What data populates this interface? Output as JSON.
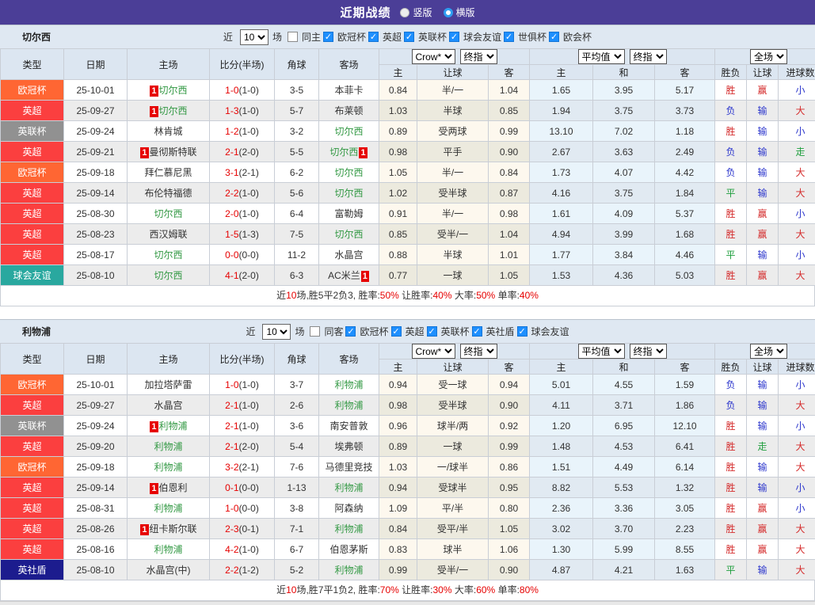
{
  "topbar": {
    "title": "近期战绩",
    "options": [
      {
        "label": "竖版",
        "selected": true
      },
      {
        "label": "横版",
        "selected": false
      }
    ]
  },
  "colors": {
    "topbar_bg": "#4b3e97",
    "section_band_bg": "#dfe8f2",
    "header_bg": "#dce6f1",
    "score_red": "#e60000",
    "team_green": "#339944"
  },
  "type_colors": {
    "欧冠杯": "#ff6633",
    "英超": "#fb3f3f",
    "英联杯": "#919191",
    "球会友谊": "#29a89f",
    "英社盾": "#1c1c8e"
  },
  "result_colors": {
    "胜": "red",
    "负": "blue",
    "平": "green",
    "赢": "red",
    "输": "blue",
    "走": "green",
    "大": "red",
    "小": "blue"
  },
  "table_header": {
    "cols": [
      "类型",
      "日期",
      "主场",
      "比分(半场)",
      "角球",
      "客场"
    ],
    "odds_group": {
      "selects": [
        "Crow*",
        "终指"
      ],
      "cols": [
        "主",
        "让球",
        "客"
      ]
    },
    "avg_group": {
      "selects": [
        "平均值",
        "终指"
      ],
      "cols": [
        "主",
        "和",
        "客"
      ]
    },
    "result_group": {
      "selects": [
        "全场"
      ],
      "cols": [
        "胜负",
        "让球",
        "进球数"
      ]
    }
  },
  "sections": [
    {
      "team": "切尔西",
      "filter": {
        "prefix": "近",
        "count": "10",
        "suffix": "场",
        "same": {
          "label": "同主",
          "checked": false
        },
        "leagues": [
          {
            "label": "欧冠杯",
            "checked": true
          },
          {
            "label": "英超",
            "checked": true
          },
          {
            "label": "英联杯",
            "checked": true
          },
          {
            "label": "球会友谊",
            "checked": true
          },
          {
            "label": "世俱杯",
            "checked": true
          },
          {
            "label": "欧会杯",
            "checked": true
          }
        ]
      },
      "rows": [
        {
          "type": "欧冠杯",
          "date": "25-10-01",
          "home": {
            "name": "切尔西",
            "green": true,
            "badge": "before"
          },
          "score": "1-0",
          "half": "(1-0)",
          "corner": "3-5",
          "away": {
            "name": "本菲卡"
          },
          "odds": [
            "0.84",
            "半/一",
            "1.04"
          ],
          "avg": [
            "1.65",
            "3.95",
            "5.17"
          ],
          "res": [
            "胜",
            "赢",
            "小"
          ]
        },
        {
          "type": "英超",
          "date": "25-09-27",
          "home": {
            "name": "切尔西",
            "green": true,
            "badge": "before"
          },
          "score": "1-3",
          "half": "(1-0)",
          "corner": "5-7",
          "away": {
            "name": "布莱顿"
          },
          "odds": [
            "1.03",
            "半球",
            "0.85"
          ],
          "avg": [
            "1.94",
            "3.75",
            "3.73"
          ],
          "res": [
            "负",
            "输",
            "大"
          ]
        },
        {
          "type": "英联杯",
          "date": "25-09-24",
          "home": {
            "name": "林肯城"
          },
          "score": "1-2",
          "half": "(1-0)",
          "corner": "3-2",
          "away": {
            "name": "切尔西",
            "green": true
          },
          "odds": [
            "0.89",
            "受两球",
            "0.99"
          ],
          "avg": [
            "13.10",
            "7.02",
            "1.18"
          ],
          "res": [
            "胜",
            "输",
            "小"
          ]
        },
        {
          "type": "英超",
          "date": "25-09-21",
          "home": {
            "name": "曼彻斯特联",
            "badge": "before"
          },
          "score": "2-1",
          "half": "(2-0)",
          "corner": "5-5",
          "away": {
            "name": "切尔西",
            "green": true,
            "badge": "after"
          },
          "odds": [
            "0.98",
            "平手",
            "0.90"
          ],
          "avg": [
            "2.67",
            "3.63",
            "2.49"
          ],
          "res": [
            "负",
            "输",
            "走"
          ]
        },
        {
          "type": "欧冠杯",
          "date": "25-09-18",
          "home": {
            "name": "拜仁慕尼黑"
          },
          "score": "3-1",
          "half": "(2-1)",
          "corner": "6-2",
          "away": {
            "name": "切尔西",
            "green": true
          },
          "odds": [
            "1.05",
            "半/一",
            "0.84"
          ],
          "avg": [
            "1.73",
            "4.07",
            "4.42"
          ],
          "res": [
            "负",
            "输",
            "大"
          ]
        },
        {
          "type": "英超",
          "date": "25-09-14",
          "home": {
            "name": "布伦特福德"
          },
          "score": "2-2",
          "half": "(1-0)",
          "corner": "5-6",
          "away": {
            "name": "切尔西",
            "green": true
          },
          "odds": [
            "1.02",
            "受半球",
            "0.87"
          ],
          "avg": [
            "4.16",
            "3.75",
            "1.84"
          ],
          "res": [
            "平",
            "输",
            "大"
          ]
        },
        {
          "type": "英超",
          "date": "25-08-30",
          "home": {
            "name": "切尔西",
            "green": true
          },
          "score": "2-0",
          "half": "(1-0)",
          "corner": "6-4",
          "away": {
            "name": "富勒姆"
          },
          "odds": [
            "0.91",
            "半/一",
            "0.98"
          ],
          "avg": [
            "1.61",
            "4.09",
            "5.37"
          ],
          "res": [
            "胜",
            "赢",
            "小"
          ]
        },
        {
          "type": "英超",
          "date": "25-08-23",
          "home": {
            "name": "西汉姆联"
          },
          "score": "1-5",
          "half": "(1-3)",
          "corner": "7-5",
          "away": {
            "name": "切尔西",
            "green": true
          },
          "odds": [
            "0.85",
            "受半/一",
            "1.04"
          ],
          "avg": [
            "4.94",
            "3.99",
            "1.68"
          ],
          "res": [
            "胜",
            "赢",
            "大"
          ]
        },
        {
          "type": "英超",
          "date": "25-08-17",
          "home": {
            "name": "切尔西",
            "green": true
          },
          "score": "0-0",
          "half": "(0-0)",
          "corner": "11-2",
          "away": {
            "name": "水晶宫"
          },
          "odds": [
            "0.88",
            "半球",
            "1.01"
          ],
          "avg": [
            "1.77",
            "3.84",
            "4.46"
          ],
          "res": [
            "平",
            "输",
            "小"
          ]
        },
        {
          "type": "球会友谊",
          "date": "25-08-10",
          "home": {
            "name": "切尔西",
            "green": true
          },
          "score": "4-1",
          "half": "(2-0)",
          "corner": "6-3",
          "away": {
            "name": "AC米兰",
            "badge": "after"
          },
          "odds": [
            "0.77",
            "一球",
            "1.05"
          ],
          "avg": [
            "1.53",
            "4.36",
            "5.03"
          ],
          "res": [
            "胜",
            "赢",
            "大"
          ]
        }
      ],
      "summary": [
        {
          "t": "近",
          "c": "k"
        },
        {
          "t": "10",
          "c": "r"
        },
        {
          "t": "场,胜5平2负3, 胜率:",
          "c": "k"
        },
        {
          "t": "50%",
          "c": "r"
        },
        {
          "t": " 让胜率:",
          "c": "k"
        },
        {
          "t": "40%",
          "c": "r"
        },
        {
          "t": " 大率:",
          "c": "k"
        },
        {
          "t": "50%",
          "c": "r"
        },
        {
          "t": " 单率:",
          "c": "k"
        },
        {
          "t": "40%",
          "c": "r"
        }
      ]
    },
    {
      "team": "利物浦",
      "filter": {
        "prefix": "近",
        "count": "10",
        "suffix": "场",
        "same": {
          "label": "同客",
          "checked": false
        },
        "leagues": [
          {
            "label": "欧冠杯",
            "checked": true
          },
          {
            "label": "英超",
            "checked": true
          },
          {
            "label": "英联杯",
            "checked": true
          },
          {
            "label": "英社盾",
            "checked": true
          },
          {
            "label": "球会友谊",
            "checked": true
          }
        ]
      },
      "rows": [
        {
          "type": "欧冠杯",
          "date": "25-10-01",
          "home": {
            "name": "加拉塔萨雷"
          },
          "score": "1-0",
          "half": "(1-0)",
          "corner": "3-7",
          "away": {
            "name": "利物浦",
            "green": true
          },
          "odds": [
            "0.94",
            "受一球",
            "0.94"
          ],
          "avg": [
            "5.01",
            "4.55",
            "1.59"
          ],
          "res": [
            "负",
            "输",
            "小"
          ]
        },
        {
          "type": "英超",
          "date": "25-09-27",
          "home": {
            "name": "水晶宫"
          },
          "score": "2-1",
          "half": "(1-0)",
          "corner": "2-6",
          "away": {
            "name": "利物浦",
            "green": true
          },
          "odds": [
            "0.98",
            "受半球",
            "0.90"
          ],
          "avg": [
            "4.11",
            "3.71",
            "1.86"
          ],
          "res": [
            "负",
            "输",
            "大"
          ]
        },
        {
          "type": "英联杯",
          "date": "25-09-24",
          "home": {
            "name": "利物浦",
            "green": true,
            "badge": "before"
          },
          "score": "2-1",
          "half": "(1-0)",
          "corner": "3-6",
          "away": {
            "name": "南安普敦"
          },
          "odds": [
            "0.96",
            "球半/两",
            "0.92"
          ],
          "avg": [
            "1.20",
            "6.95",
            "12.10"
          ],
          "res": [
            "胜",
            "输",
            "小"
          ]
        },
        {
          "type": "英超",
          "date": "25-09-20",
          "home": {
            "name": "利物浦",
            "green": true
          },
          "score": "2-1",
          "half": "(2-0)",
          "corner": "5-4",
          "away": {
            "name": "埃弗顿"
          },
          "odds": [
            "0.89",
            "一球",
            "0.99"
          ],
          "avg": [
            "1.48",
            "4.53",
            "6.41"
          ],
          "res": [
            "胜",
            "走",
            "大"
          ]
        },
        {
          "type": "欧冠杯",
          "date": "25-09-18",
          "home": {
            "name": "利物浦",
            "green": true
          },
          "score": "3-2",
          "half": "(2-1)",
          "corner": "7-6",
          "away": {
            "name": "马德里竞技"
          },
          "odds": [
            "1.03",
            "一/球半",
            "0.86"
          ],
          "avg": [
            "1.51",
            "4.49",
            "6.14"
          ],
          "res": [
            "胜",
            "输",
            "大"
          ]
        },
        {
          "type": "英超",
          "date": "25-09-14",
          "home": {
            "name": "伯恩利",
            "badge": "before"
          },
          "score": "0-1",
          "half": "(0-0)",
          "corner": "1-13",
          "away": {
            "name": "利物浦",
            "green": true
          },
          "odds": [
            "0.94",
            "受球半",
            "0.95"
          ],
          "avg": [
            "8.82",
            "5.53",
            "1.32"
          ],
          "res": [
            "胜",
            "输",
            "小"
          ]
        },
        {
          "type": "英超",
          "date": "25-08-31",
          "home": {
            "name": "利物浦",
            "green": true
          },
          "score": "1-0",
          "half": "(0-0)",
          "corner": "3-8",
          "away": {
            "name": "阿森纳"
          },
          "odds": [
            "1.09",
            "平/半",
            "0.80"
          ],
          "avg": [
            "2.36",
            "3.36",
            "3.05"
          ],
          "res": [
            "胜",
            "赢",
            "小"
          ]
        },
        {
          "type": "英超",
          "date": "25-08-26",
          "home": {
            "name": "纽卡斯尔联",
            "badge": "before"
          },
          "score": "2-3",
          "half": "(0-1)",
          "corner": "7-1",
          "away": {
            "name": "利物浦",
            "green": true
          },
          "odds": [
            "0.84",
            "受平/半",
            "1.05"
          ],
          "avg": [
            "3.02",
            "3.70",
            "2.23"
          ],
          "res": [
            "胜",
            "赢",
            "大"
          ]
        },
        {
          "type": "英超",
          "date": "25-08-16",
          "home": {
            "name": "利物浦",
            "green": true
          },
          "score": "4-2",
          "half": "(1-0)",
          "corner": "6-7",
          "away": {
            "name": "伯恩茅斯"
          },
          "odds": [
            "0.83",
            "球半",
            "1.06"
          ],
          "avg": [
            "1.30",
            "5.99",
            "8.55"
          ],
          "res": [
            "胜",
            "赢",
            "大"
          ]
        },
        {
          "type": "英社盾",
          "date": "25-08-10",
          "home": {
            "name": "水晶宫(中)"
          },
          "score": "2-2",
          "half": "(1-2)",
          "corner": "5-2",
          "away": {
            "name": "利物浦",
            "green": true
          },
          "odds": [
            "0.99",
            "受半/一",
            "0.90"
          ],
          "avg": [
            "4.87",
            "4.21",
            "1.63"
          ],
          "res": [
            "平",
            "输",
            "大"
          ]
        }
      ],
      "summary": [
        {
          "t": "近",
          "c": "k"
        },
        {
          "t": "10",
          "c": "r"
        },
        {
          "t": "场,胜7平1负2, 胜率:",
          "c": "k"
        },
        {
          "t": "70%",
          "c": "r"
        },
        {
          "t": " 让胜率:",
          "c": "k"
        },
        {
          "t": "30%",
          "c": "r"
        },
        {
          "t": " 大率:",
          "c": "k"
        },
        {
          "t": "60%",
          "c": "r"
        },
        {
          "t": " 单率:",
          "c": "k"
        },
        {
          "t": "80%",
          "c": "r"
        }
      ]
    }
  ]
}
